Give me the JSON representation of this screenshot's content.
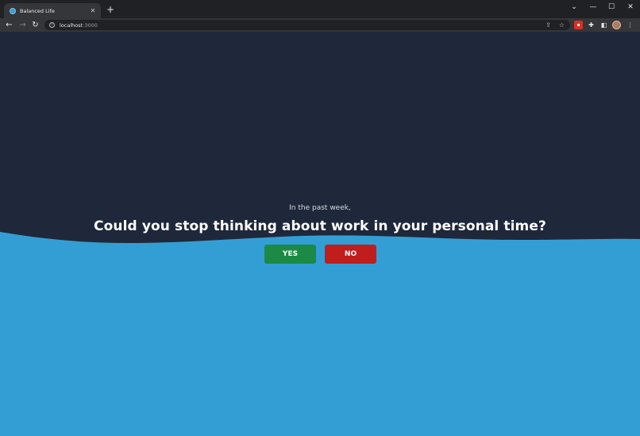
{
  "browser": {
    "tab_title": "Balanced Life",
    "tab_close": "✕",
    "new_tab": "+",
    "url_host": "localhost",
    "url_port": ":3000",
    "window_controls": {
      "dropdown": "⌄",
      "minimize": "—",
      "maximize": "☐",
      "close": "✕"
    },
    "nav": {
      "back": "←",
      "forward": "→",
      "reload": "↻"
    },
    "icons": [
      "share-icon",
      "star-icon",
      "extension-red-icon",
      "puzzle-icon",
      "side-panel-icon",
      "avatar",
      "menu-icon"
    ]
  },
  "question": {
    "prefix": "In the past week,",
    "text": "Could you stop thinking about work in your personal time?",
    "yes_label": "YES",
    "no_label": "NO"
  },
  "colors": {
    "page_dark": "#1f283a",
    "wave_blue": "#339ed4",
    "yes_green": "#1a8a44",
    "no_red": "#c01d1d"
  }
}
